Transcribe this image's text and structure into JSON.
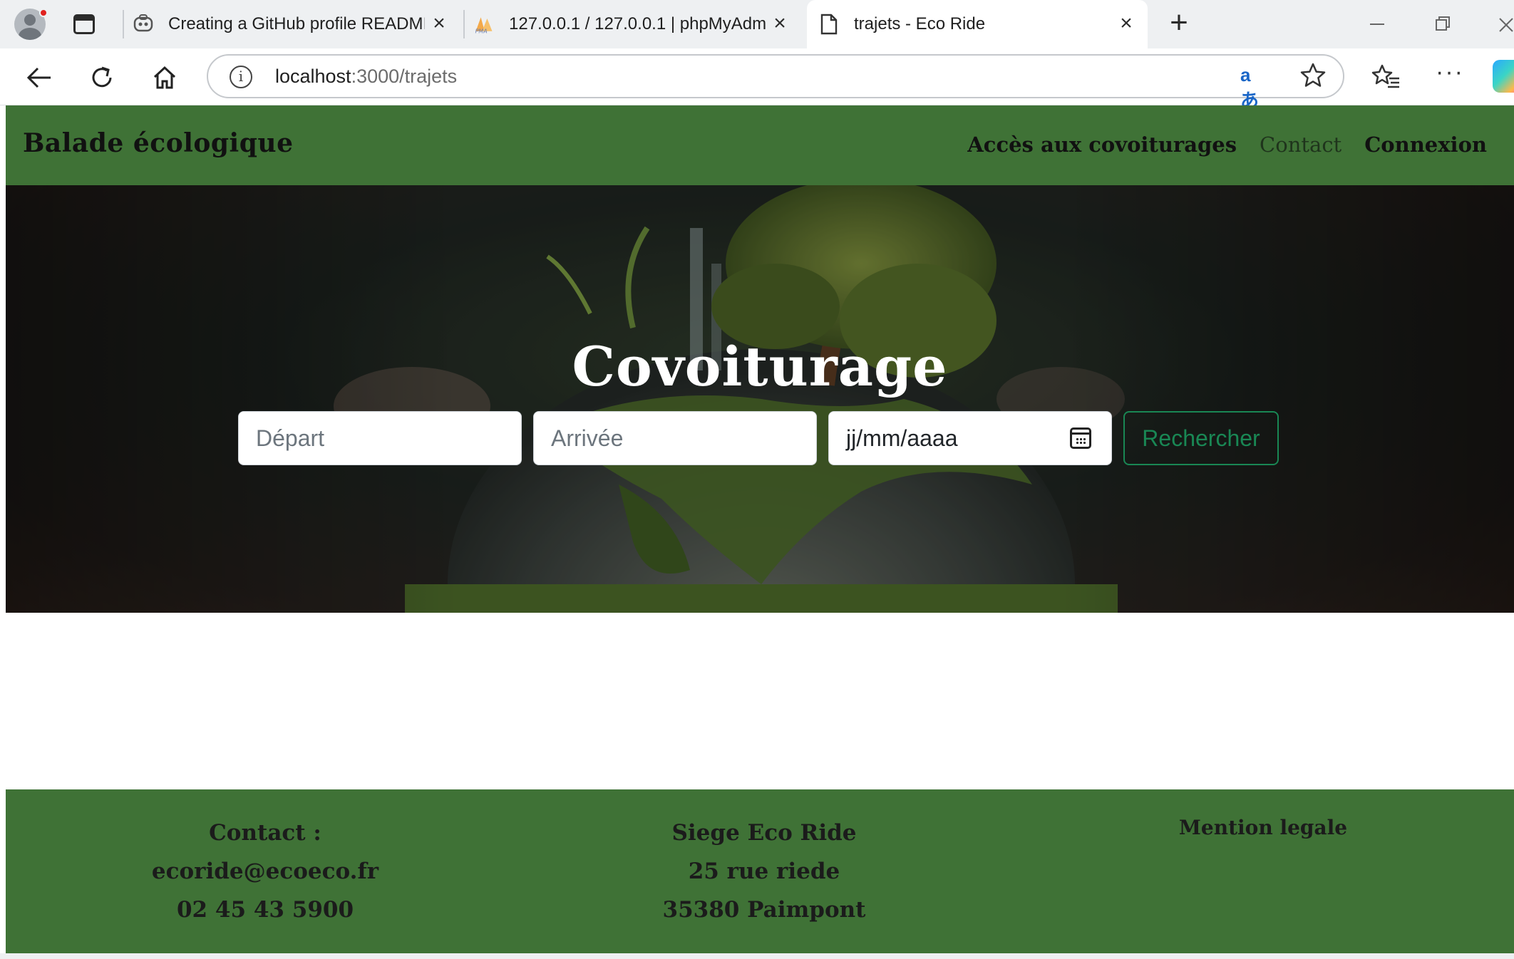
{
  "browser": {
    "tabs": [
      {
        "title": "Creating a GitHub profile READMI",
        "active": false,
        "favicon": "copilot-icon"
      },
      {
        "title": "127.0.0.1 / 127.0.0.1 | phpMyAdm",
        "active": false,
        "favicon": "phpmyadmin-icon"
      },
      {
        "title": "trajets - Eco Ride",
        "active": true,
        "favicon": "page-icon"
      }
    ],
    "url_host": "localhost",
    "url_path": ":3000/trajets"
  },
  "site": {
    "brand": "Balade écologique",
    "nav": [
      {
        "label": "Accès aux covoiturages"
      },
      {
        "label": "Contact"
      },
      {
        "label": "Connexion"
      }
    ]
  },
  "hero": {
    "title": "Covoiturage",
    "search": {
      "departure_placeholder": "Départ",
      "arrival_placeholder": "Arrivée",
      "date_placeholder": "jj/mm/aaaa",
      "button_label": "Rechercher"
    }
  },
  "footer": {
    "contact_title": "Contact :",
    "contact_email": "ecoride@ecoeco.fr",
    "contact_phone": "02 45 43 5900",
    "hq_title": "Siege Eco Ride",
    "hq_street": "25 rue riede",
    "hq_city": "35380 Paimpont",
    "legal_label": "Mention legale"
  },
  "colors": {
    "brand_green": "#3f7236",
    "button_green": "#198754"
  }
}
